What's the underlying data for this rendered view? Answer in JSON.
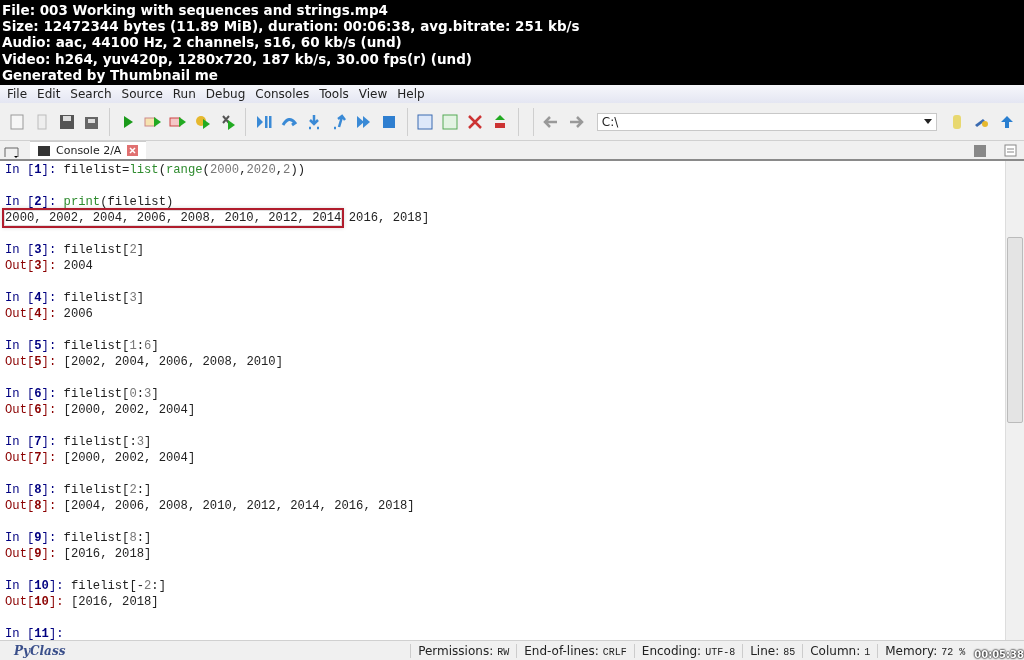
{
  "video_info": [
    "File: 003 Working with sequences and strings.mp4",
    "Size: 12472344 bytes (11.89 MiB), duration: 00:06:38, avg.bitrate: 251 kb/s",
    "Audio: aac, 44100 Hz, 2 channels, s16, 60 kb/s (und)",
    "Video: h264, yuv420p, 1280x720, 187 kb/s, 30.00 fps(r) (und)",
    "Generated by Thumbnail me"
  ],
  "menu": [
    "File",
    "Edit",
    "Search",
    "Source",
    "Run",
    "Debug",
    "Consoles",
    "Tools",
    "View",
    "Help"
  ],
  "path_field": {
    "value": "C:\\"
  },
  "tabs": [
    {
      "label": "Console 2/A",
      "selected": true
    }
  ],
  "console": [
    {
      "kind": "in",
      "prompt": "In [**1**]:",
      "code": [
        {
          "text": "filelist=",
          "kind": "plain"
        },
        {
          "text": "list",
          "kind": "builtin"
        },
        {
          "text": "(",
          "kind": "plain"
        },
        {
          "text": "range",
          "kind": "builtin"
        },
        {
          "text": "(",
          "kind": "plain"
        },
        {
          "text": "2000",
          "kind": "num"
        },
        {
          "text": ",",
          "kind": "plain"
        },
        {
          "text": "2020",
          "kind": "num"
        },
        {
          "text": ",",
          "kind": "plain"
        },
        {
          "text": "2",
          "kind": "num"
        },
        {
          "text": "))",
          "kind": "plain"
        }
      ]
    },
    {
      "kind": "blank"
    },
    {
      "kind": "in",
      "prompt": "In [**2**]:",
      "code": [
        {
          "text": "print",
          "kind": "builtin"
        },
        {
          "text": "(filelist)",
          "kind": "plain"
        }
      ]
    },
    {
      "kind": "stdout",
      "parts": [
        {
          "text": "2000, 2002, 2004, 2006, 2008, 2010, 2012, 2014",
          "highlighted": true
        },
        {
          "text": "2016, 2018]",
          "highlighted": false
        }
      ]
    },
    {
      "kind": "blank"
    },
    {
      "kind": "in",
      "prompt": "In [**3**]:",
      "code": [
        {
          "text": "filelist[",
          "kind": "plain"
        },
        {
          "text": "2",
          "kind": "num"
        },
        {
          "text": "]",
          "kind": "plain"
        }
      ]
    },
    {
      "kind": "out",
      "prompt": "Out[**3**]:",
      "text": "2004"
    },
    {
      "kind": "blank"
    },
    {
      "kind": "in",
      "prompt": "In [**4**]:",
      "code": [
        {
          "text": "filelist[",
          "kind": "plain"
        },
        {
          "text": "3",
          "kind": "num"
        },
        {
          "text": "]",
          "kind": "plain"
        }
      ]
    },
    {
      "kind": "out",
      "prompt": "Out[**4**]:",
      "text": "2006"
    },
    {
      "kind": "blank"
    },
    {
      "kind": "in",
      "prompt": "In [**5**]:",
      "code": [
        {
          "text": "filelist[",
          "kind": "plain"
        },
        {
          "text": "1",
          "kind": "num"
        },
        {
          "text": ":",
          "kind": "plain"
        },
        {
          "text": "6",
          "kind": "num"
        },
        {
          "text": "]",
          "kind": "plain"
        }
      ]
    },
    {
      "kind": "out",
      "prompt": "Out[**5**]:",
      "text": "[2002, 2004, 2006, 2008, 2010]"
    },
    {
      "kind": "blank"
    },
    {
      "kind": "in",
      "prompt": "In [**6**]:",
      "code": [
        {
          "text": "filelist[",
          "kind": "plain"
        },
        {
          "text": "0",
          "kind": "num"
        },
        {
          "text": ":",
          "kind": "plain"
        },
        {
          "text": "3",
          "kind": "num"
        },
        {
          "text": "]",
          "kind": "plain"
        }
      ]
    },
    {
      "kind": "out",
      "prompt": "Out[**6**]:",
      "text": "[2000, 2002, 2004]"
    },
    {
      "kind": "blank"
    },
    {
      "kind": "in",
      "prompt": "In [**7**]:",
      "code": [
        {
          "text": "filelist[:",
          "kind": "plain"
        },
        {
          "text": "3",
          "kind": "num"
        },
        {
          "text": "]",
          "kind": "plain"
        }
      ]
    },
    {
      "kind": "out",
      "prompt": "Out[**7**]:",
      "text": "[2000, 2002, 2004]"
    },
    {
      "kind": "blank"
    },
    {
      "kind": "in",
      "prompt": "In [**8**]:",
      "code": [
        {
          "text": "filelist[",
          "kind": "plain"
        },
        {
          "text": "2",
          "kind": "num"
        },
        {
          "text": ":]",
          "kind": "plain"
        }
      ]
    },
    {
      "kind": "out",
      "prompt": "Out[**8**]:",
      "text": "[2004, 2006, 2008, 2010, 2012, 2014, 2016, 2018]"
    },
    {
      "kind": "blank"
    },
    {
      "kind": "in",
      "prompt": "In [**9**]:",
      "code": [
        {
          "text": "filelist[",
          "kind": "plain"
        },
        {
          "text": "8",
          "kind": "num"
        },
        {
          "text": ":]",
          "kind": "plain"
        }
      ]
    },
    {
      "kind": "out",
      "prompt": "Out[**9**]:",
      "text": "[2016, 2018]"
    },
    {
      "kind": "blank"
    },
    {
      "kind": "in",
      "prompt": "In [**10**]:",
      "code": [
        {
          "text": "filelist[-",
          "kind": "plain"
        },
        {
          "text": "2",
          "kind": "num"
        },
        {
          "text": ":]",
          "kind": "plain"
        }
      ]
    },
    {
      "kind": "out",
      "prompt": "Out[**10**]:",
      "text": "[2016, 2018]"
    },
    {
      "kind": "blank"
    },
    {
      "kind": "in",
      "prompt": "In [**11**]:"
    }
  ],
  "status_bar": {
    "logo": "PyClass",
    "items": [
      {
        "label": "Permissions:",
        "value": "RW"
      },
      {
        "label": "End-of-lines:",
        "value": "CRLF"
      },
      {
        "label": "Encoding:",
        "value": "UTF-8"
      },
      {
        "label": "Line:",
        "value": "85"
      },
      {
        "label": "Column:",
        "value": "1"
      },
      {
        "label": "Memory:",
        "value": "72 %"
      }
    ]
  },
  "timestamp": "00:05:38"
}
